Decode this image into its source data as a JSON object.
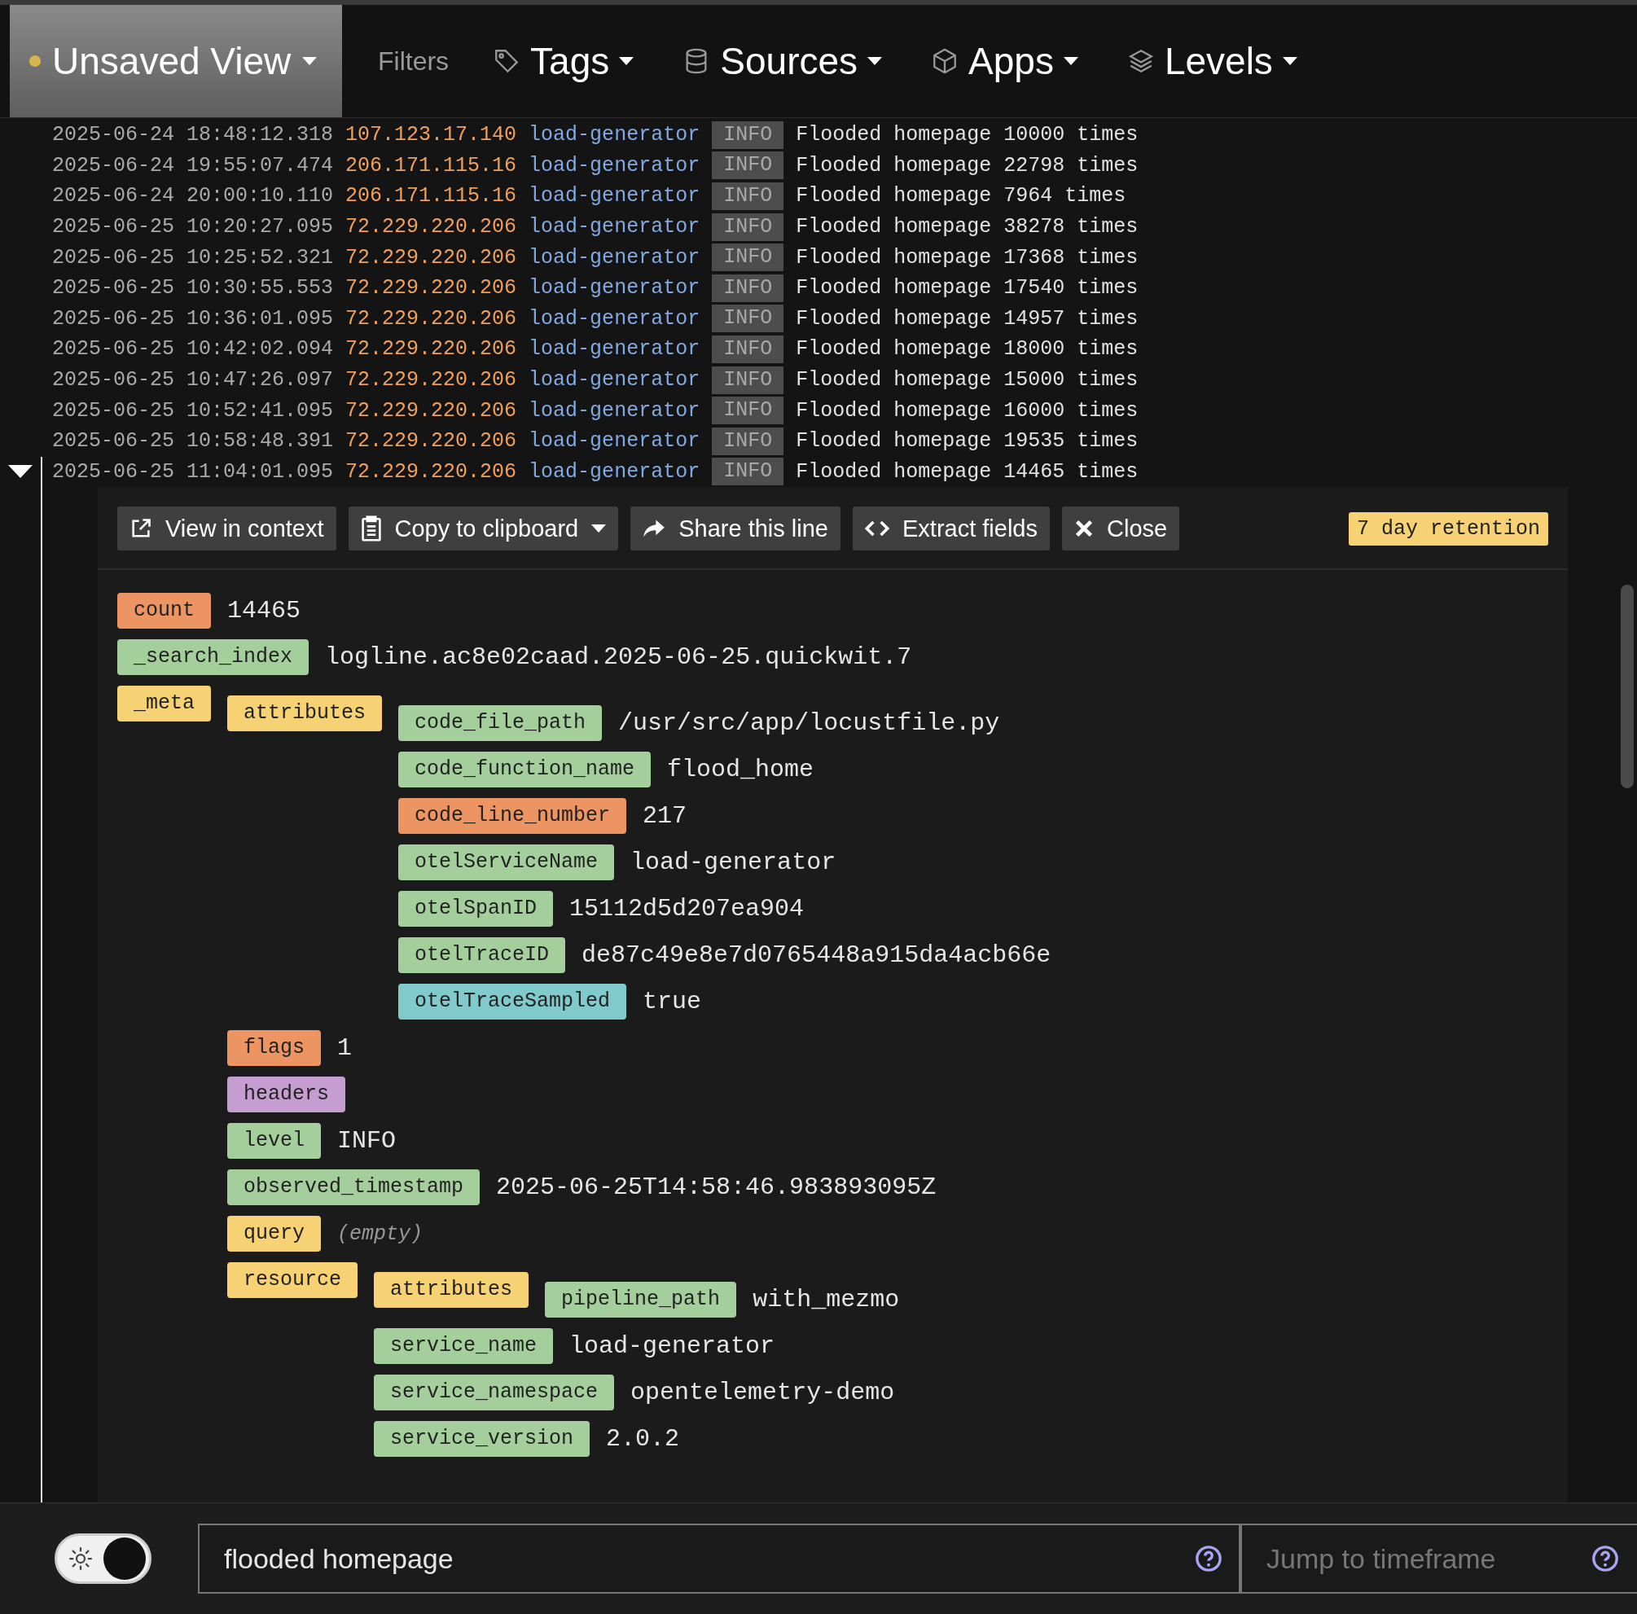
{
  "nav": {
    "view": {
      "label": "Unsaved View"
    },
    "filters_label": "Filters",
    "menus": [
      {
        "kind": "tag",
        "label": "Tags"
      },
      {
        "kind": "database",
        "label": "Sources"
      },
      {
        "kind": "cube",
        "label": "Apps"
      },
      {
        "kind": "layers",
        "label": "Levels"
      }
    ]
  },
  "log_rows": [
    {
      "time": "2025-06-24 18:48:12.318",
      "host": "107.123.17.140",
      "app": "load-generator",
      "level": "INFO",
      "message": "Flooded homepage 10000 times",
      "expanded": false
    },
    {
      "time": "2025-06-24 19:55:07.474",
      "host": "206.171.115.16",
      "app": "load-generator",
      "level": "INFO",
      "message": "Flooded homepage 22798 times",
      "expanded": false
    },
    {
      "time": "2025-06-24 20:00:10.110",
      "host": "206.171.115.16",
      "app": "load-generator",
      "level": "INFO",
      "message": "Flooded homepage 7964 times",
      "expanded": false
    },
    {
      "time": "2025-06-25 10:20:27.095",
      "host": "72.229.220.206",
      "app": "load-generator",
      "level": "INFO",
      "message": "Flooded homepage 38278 times",
      "expanded": false
    },
    {
      "time": "2025-06-25 10:25:52.321",
      "host": "72.229.220.206",
      "app": "load-generator",
      "level": "INFO",
      "message": "Flooded homepage 17368 times",
      "expanded": false
    },
    {
      "time": "2025-06-25 10:30:55.553",
      "host": "72.229.220.206",
      "app": "load-generator",
      "level": "INFO",
      "message": "Flooded homepage 17540 times",
      "expanded": false
    },
    {
      "time": "2025-06-25 10:36:01.095",
      "host": "72.229.220.206",
      "app": "load-generator",
      "level": "INFO",
      "message": "Flooded homepage 14957 times",
      "expanded": false
    },
    {
      "time": "2025-06-25 10:42:02.094",
      "host": "72.229.220.206",
      "app": "load-generator",
      "level": "INFO",
      "message": "Flooded homepage 18000 times",
      "expanded": false
    },
    {
      "time": "2025-06-25 10:47:26.097",
      "host": "72.229.220.206",
      "app": "load-generator",
      "level": "INFO",
      "message": "Flooded homepage 15000 times",
      "expanded": false
    },
    {
      "time": "2025-06-25 10:52:41.095",
      "host": "72.229.220.206",
      "app": "load-generator",
      "level": "INFO",
      "message": "Flooded homepage 16000 times",
      "expanded": false
    },
    {
      "time": "2025-06-25 10:58:48.391",
      "host": "72.229.220.206",
      "app": "load-generator",
      "level": "INFO",
      "message": "Flooded homepage 19535 times",
      "expanded": false
    },
    {
      "time": "2025-06-25 11:04:01.095",
      "host": "72.229.220.206",
      "app": "load-generator",
      "level": "INFO",
      "message": "Flooded homepage 14465 times",
      "expanded": true
    }
  ],
  "detail": {
    "actions": [
      {
        "kind": "external",
        "label": "View in context"
      },
      {
        "kind": "clipboard",
        "label": "Copy to clipboard",
        "dropdown": true
      },
      {
        "kind": "share",
        "label": "Share this line",
        "dropdown": false
      },
      {
        "kind": "code",
        "label": "Extract fields",
        "dropdown": false
      },
      {
        "kind": "close",
        "label": "Close",
        "dropdown": false
      }
    ],
    "retention": "7 day retention",
    "fields": [
      {
        "key": "count",
        "kind": "number",
        "value": "14465"
      },
      {
        "key": "_search_index",
        "kind": "string",
        "value": "logline.ac8e02caad.2025-06-25.quickwit.7"
      },
      {
        "key": "_meta",
        "kind": "object",
        "children": [
          {
            "key": "attributes",
            "kind": "object",
            "children": [
              {
                "key": "code_file_path",
                "kind": "string",
                "value": "/usr/src/app/locustfile.py"
              },
              {
                "key": "code_function_name",
                "kind": "string",
                "value": "flood_home"
              },
              {
                "key": "code_line_number",
                "kind": "number",
                "value": "217"
              },
              {
                "key": "otelServiceName",
                "kind": "string",
                "value": "load-generator"
              },
              {
                "key": "otelSpanID",
                "kind": "string",
                "value": "15112d5d207ea904"
              },
              {
                "key": "otelTraceID",
                "kind": "string",
                "value": "de87c49e8e7d0765448a915da4acb66e"
              },
              {
                "key": "otelTraceSampled",
                "kind": "boolean",
                "value": "true"
              }
            ]
          },
          {
            "key": "flags",
            "kind": "number",
            "value": "1"
          },
          {
            "key": "headers",
            "kind": "map"
          },
          {
            "key": "level",
            "kind": "string",
            "value": "INFO"
          },
          {
            "key": "observed_timestamp",
            "kind": "string",
            "value": "2025-06-25T14:58:46.983893095Z"
          },
          {
            "key": "query",
            "kind": "empty",
            "value": "(empty)"
          },
          {
            "key": "resource",
            "kind": "object",
            "children": [
              {
                "key": "attributes",
                "kind": "object",
                "children": [
                  {
                    "key": "pipeline_path",
                    "kind": "string",
                    "value": "with_mezmo"
                  }
                ]
              },
              {
                "key": "service_name",
                "kind": "string",
                "value": "load-generator"
              },
              {
                "key": "service_namespace",
                "kind": "string",
                "value": "opentelemetry-demo"
              },
              {
                "key": "service_version",
                "kind": "string",
                "value": "2.0.2"
              }
            ]
          }
        ]
      }
    ]
  },
  "bottom_bar": {
    "dark_mode": true,
    "search": {
      "value": "flooded homepage"
    },
    "timeframe": {
      "placeholder": "Jump to timeframe"
    }
  }
}
